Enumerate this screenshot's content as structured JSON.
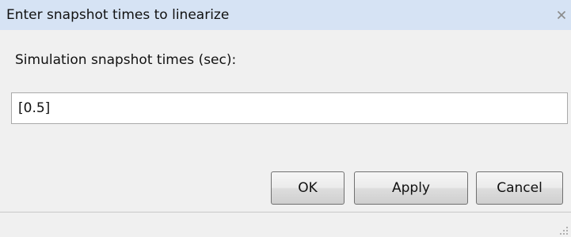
{
  "window": {
    "title": "Enter snapshot times to linearize",
    "close_icon": "close-icon"
  },
  "form": {
    "label": "Simulation snapshot times (sec):",
    "value": "[0.5]"
  },
  "buttons": {
    "ok": "OK",
    "apply": "Apply",
    "cancel": "Cancel"
  },
  "colors": {
    "titlebar": "#d6e3f4",
    "background": "#f0f0f0",
    "input_background": "#ffffff"
  }
}
